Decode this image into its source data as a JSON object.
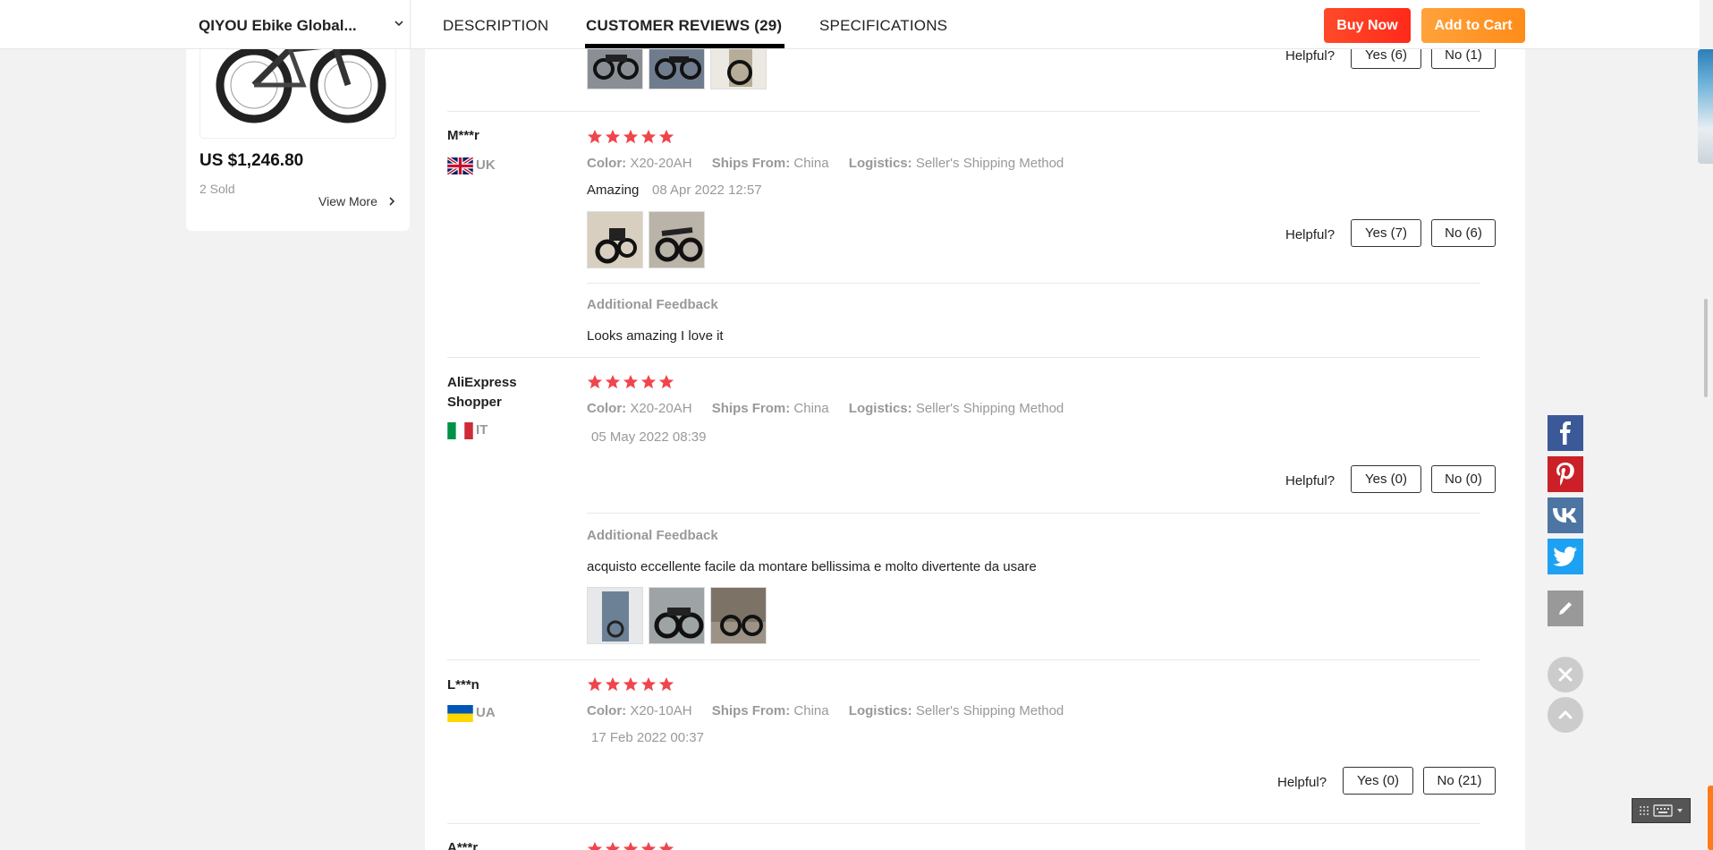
{
  "header": {
    "store_name": "QIYOU Ebike Global...",
    "tabs": [
      {
        "label": "DESCRIPTION",
        "active": false
      },
      {
        "label": "CUSTOMER REVIEWS (29)",
        "active": true
      },
      {
        "label": "SPECIFICATIONS",
        "active": false
      }
    ],
    "buy_now_label": "Buy Now",
    "add_to_cart_label": "Add to Cart"
  },
  "sidebar_product": {
    "price": "US $1,246.80",
    "sold": "2 Sold",
    "view_more": "View More"
  },
  "reviews": [
    {
      "partial": true,
      "helpful_label": "Helpful?",
      "yes_label": "Yes (6)",
      "no_label": "No (1)"
    },
    {
      "name": "M***r",
      "country": "UK",
      "rating": 5,
      "color_label": "Color:",
      "color_value": "X20-20AH",
      "ships_label": "Ships From:",
      "ships_value": "China",
      "logistics_label": "Logistics:",
      "logistics_value": "Seller's Shipping Method",
      "text": "Amazing",
      "date": "08 Apr 2022 12:57",
      "helpful_label": "Helpful?",
      "yes_label": "Yes (7)",
      "no_label": "No (6)",
      "additional_feedback_title": "Additional Feedback",
      "additional_feedback_text": "Looks amazing I love it"
    },
    {
      "name": "AliExpress Shopper",
      "country": "IT",
      "rating": 5,
      "color_label": "Color:",
      "color_value": "X20-20AH",
      "ships_label": "Ships From:",
      "ships_value": "China",
      "logistics_label": "Logistics:",
      "logistics_value": "Seller's Shipping Method",
      "date": "05 May 2022 08:39",
      "helpful_label": "Helpful?",
      "yes_label": "Yes (0)",
      "no_label": "No (0)",
      "additional_feedback_title": "Additional Feedback",
      "additional_feedback_text": "acquisto eccellente facile da montare bellissima e molto divertente da usare"
    },
    {
      "name": "L***n",
      "country": "UA",
      "rating": 5,
      "color_label": "Color:",
      "color_value": "X20-10AH",
      "ships_label": "Ships From:",
      "ships_value": "China",
      "logistics_label": "Logistics:",
      "logistics_value": "Seller's Shipping Method",
      "date": "17 Feb 2022 00:37",
      "helpful_label": "Helpful?",
      "yes_label": "Yes (0)",
      "no_label": "No (21)"
    },
    {
      "name": "A***r",
      "partial": true
    }
  ],
  "share": {
    "icons": [
      "facebook-icon",
      "pinterest-icon",
      "vk-icon",
      "twitter-icon",
      "edit-icon"
    ]
  },
  "colors": {
    "star": "#f0454c",
    "buy_now": "#ff3b1f",
    "add_to_cart": "#ff941f"
  }
}
